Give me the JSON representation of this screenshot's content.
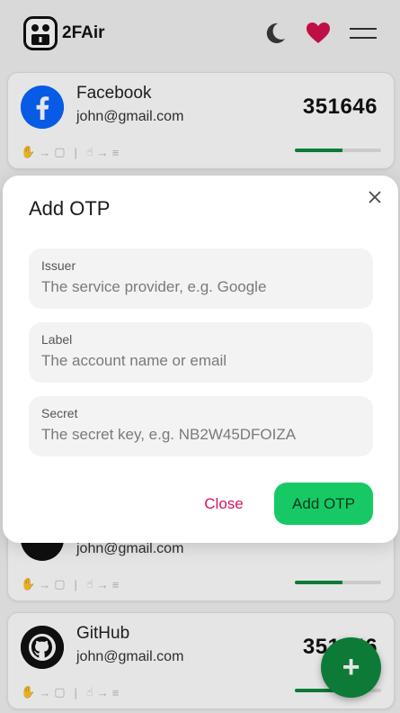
{
  "app": {
    "name": "2FAir"
  },
  "header": {
    "logo_icon": "robot-lock-icon",
    "theme_icon": "moon-icon",
    "favorite_icon": "heart-icon",
    "menu_icon": "hamburger-menu-icon"
  },
  "accounts": [
    {
      "issuer": "Facebook",
      "label": "john@gmail.com",
      "code": "351646",
      "progress": 0.55
    },
    {
      "issuer": "",
      "label": "john@gmail.com",
      "code": "",
      "progress": 0.55
    },
    {
      "issuer": "GitHub",
      "label": "john@gmail.com",
      "code": "351646",
      "progress": 0.55
    }
  ],
  "steps": {
    "arrow": "→",
    "separator": "|",
    "copy_icon": "copy-icon",
    "menu_icon": "lines-icon"
  },
  "fab": {
    "label": "+"
  },
  "modal": {
    "title": "Add OTP",
    "fields": {
      "issuer": {
        "label": "Issuer",
        "placeholder": "The service provider, e.g. Google"
      },
      "label": {
        "label": "Label",
        "placeholder": "The account name or email"
      },
      "secret": {
        "label": "Secret",
        "placeholder": "The secret key, e.g. NB2W45DFOIZA"
      }
    },
    "close_label": "Close",
    "submit_label": "Add OTP"
  },
  "colors": {
    "accent": "#17c964",
    "danger": "#e0115f",
    "progress": "#0d8a3c",
    "heart": "#d6114e"
  }
}
